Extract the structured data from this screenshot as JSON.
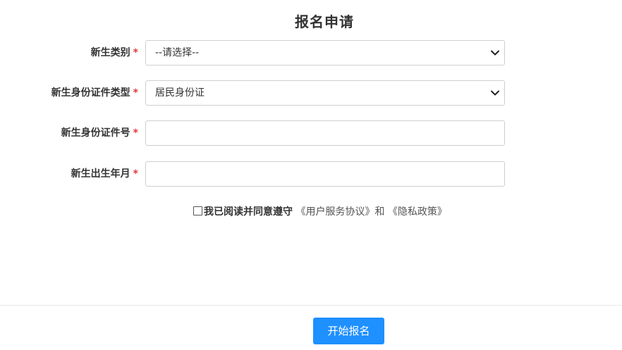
{
  "header": {
    "title": "报名申请"
  },
  "form": {
    "fields": [
      {
        "label": "新生类别",
        "required_mark": "*",
        "type": "select",
        "value": "--请选择--"
      },
      {
        "label": "新生身份证件类型",
        "required_mark": "*",
        "type": "select",
        "value": "居民身份证"
      },
      {
        "label": "新生身份证件号",
        "required_mark": "*",
        "type": "input",
        "value": "",
        "placeholder": ""
      },
      {
        "label": "新生出生年月",
        "required_mark": "*",
        "type": "input",
        "value": "",
        "placeholder": ""
      }
    ],
    "agreement": {
      "checked": false,
      "prefix": "我已阅读并同意遵守",
      "user_agreement": "《用户服务协议》",
      "conjunction": "和",
      "privacy_policy": "《隐私政策》"
    }
  },
  "footer": {
    "submit_label": "开始报名"
  },
  "colors": {
    "accent": "#1e90ff",
    "required": "#e4393c",
    "border": "#cfcfcf"
  },
  "icons": [
    "chevron-down-icon",
    "checkbox-icon"
  ]
}
